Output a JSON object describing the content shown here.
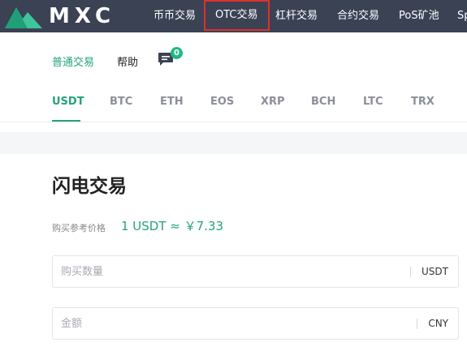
{
  "header": {
    "logo_text": "MXC",
    "nav": [
      {
        "label": "币币交易"
      },
      {
        "label": "OTC交易"
      },
      {
        "label": "杠杆交易"
      },
      {
        "label": "合约交易"
      },
      {
        "label": "PoS矿池"
      },
      {
        "label": "Sp"
      }
    ],
    "highlighted_index": 1
  },
  "subnav": {
    "items": [
      {
        "label": "普通交易",
        "active": true
      },
      {
        "label": "帮助",
        "active": false
      }
    ],
    "message_icon": "chat-bubble-icon",
    "message_count": "0"
  },
  "tabs": [
    "USDT",
    "BTC",
    "ETH",
    "EOS",
    "XRP",
    "BCH",
    "LTC",
    "TRX"
  ],
  "active_tab": "USDT",
  "main": {
    "title": "闪电交易",
    "price_label": "购买参考价格",
    "price_value": "1 USDT ≈ ￥7.33",
    "fields": [
      {
        "placeholder": "购买数量",
        "value": "",
        "unit": "USDT"
      },
      {
        "placeholder": "金额",
        "value": "",
        "unit": "CNY"
      }
    ]
  },
  "colors": {
    "header_bg": "#3a4254",
    "accent": "#23a37a",
    "highlight_border": "#e0302a",
    "badge": "#23b886"
  }
}
